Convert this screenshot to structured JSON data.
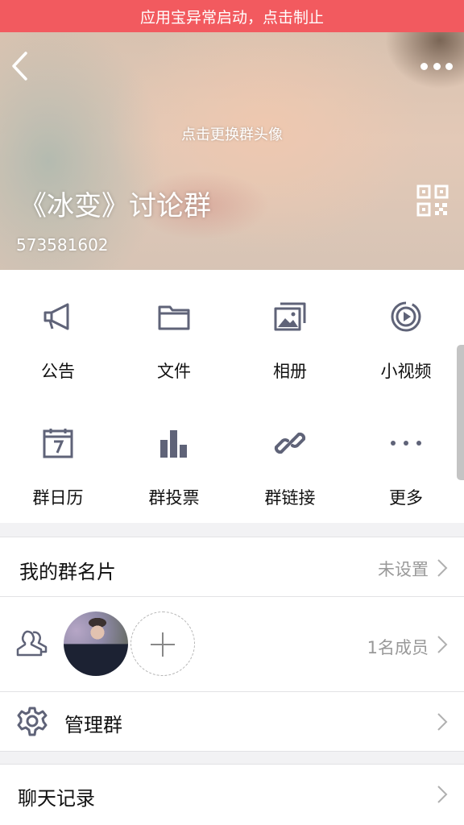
{
  "banner": {
    "text": "应用宝异常启动，点击制止"
  },
  "header": {
    "change_avatar": "点击更换群头像",
    "group_name": "《冰变》讨论群",
    "group_id": "573581602"
  },
  "features": [
    {
      "label": "公告",
      "icon": "megaphone-icon"
    },
    {
      "label": "文件",
      "icon": "folder-icon"
    },
    {
      "label": "相册",
      "icon": "photo-album-icon"
    },
    {
      "label": "小视频",
      "icon": "video-play-icon"
    },
    {
      "label": "群日历",
      "icon": "calendar-icon"
    },
    {
      "label": "群投票",
      "icon": "bar-chart-icon"
    },
    {
      "label": "群链接",
      "icon": "link-icon"
    },
    {
      "label": "更多",
      "icon": "more-dots-icon"
    }
  ],
  "card": {
    "title": "我的群名片",
    "value": "未设置"
  },
  "members": {
    "count_text": "1名成员"
  },
  "manage": {
    "title": "管理群"
  },
  "history": {
    "title": "聊天记录"
  },
  "colors": {
    "banner": "#f25a5f",
    "icon": "#5f6378",
    "text": "#111111",
    "secondary": "#999999"
  }
}
